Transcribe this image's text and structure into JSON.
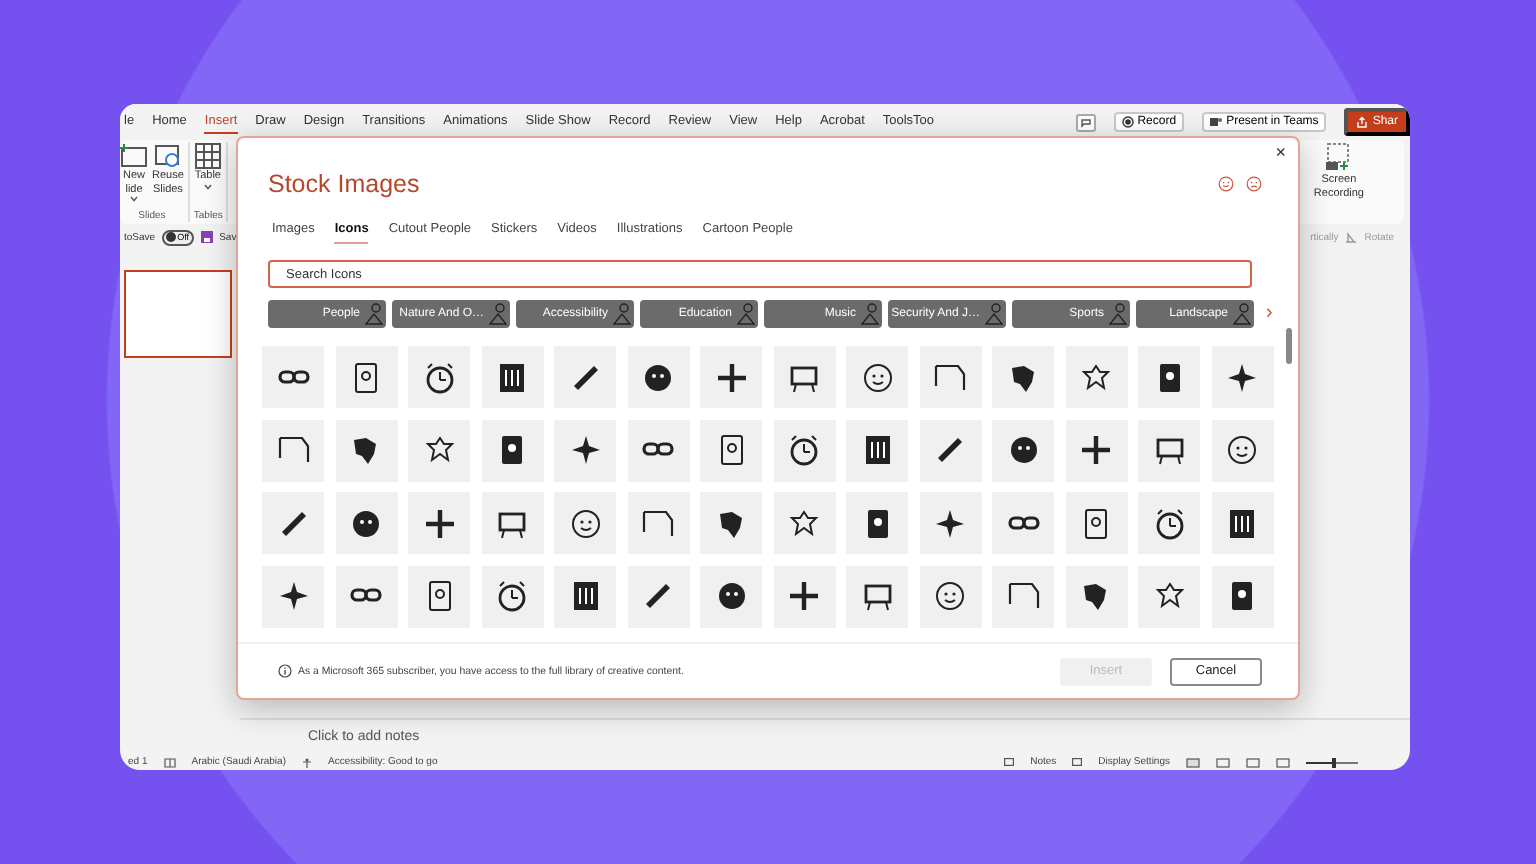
{
  "app": {
    "menu_tabs": [
      {
        "label": "le",
        "selected": false
      },
      {
        "label": "Home",
        "selected": false
      },
      {
        "label": "Insert",
        "selected": true
      },
      {
        "label": "Draw",
        "selected": false
      },
      {
        "label": "Design",
        "selected": false
      },
      {
        "label": "Transitions",
        "selected": false
      },
      {
        "label": "Animations",
        "selected": false
      },
      {
        "label": "Slide Show",
        "selected": false
      },
      {
        "label": "Record",
        "selected": false
      },
      {
        "label": "Review",
        "selected": false
      },
      {
        "label": "View",
        "selected": false
      },
      {
        "label": "Help",
        "selected": false
      },
      {
        "label": "Acrobat",
        "selected": false
      },
      {
        "label": "ToolsToo",
        "selected": false
      }
    ],
    "record_button": "Record",
    "present_button": "Present in Teams",
    "share_button": "Shar",
    "ribbon_groups": [
      {
        "label": "Slides",
        "buttons": [
          {
            "lines": [
              "New",
              "lide"
            ],
            "dropdown": true
          },
          {
            "lines": [
              "Reuse",
              "Slides"
            ],
            "dropdown": false
          }
        ]
      },
      {
        "label": "Tables",
        "buttons": [
          {
            "lines": [
              "Table"
            ],
            "dropdown": true
          }
        ]
      }
    ],
    "screen_recording": [
      "Screen",
      "Recording"
    ],
    "autosave": {
      "label": "toSave",
      "state": "Off",
      "on": false
    },
    "save_label": "Sav",
    "arrange_labels": [
      "rtically",
      "Rotate"
    ],
    "slides": [
      {
        "selected": true
      }
    ],
    "notes_placeholder": "Click to add notes",
    "status_left": [
      "ed 1",
      "Arabic (Saudi Arabia)",
      "Accessibility: Good to go"
    ],
    "status_right": [
      "Notes",
      "Display Settings"
    ],
    "zoom_slider": {
      "level": 0.5
    }
  },
  "dialog": {
    "close_glyph": "×",
    "title": "Stock Images",
    "tabs": [
      {
        "label": "Images",
        "selected": false
      },
      {
        "label": "Icons",
        "selected": true
      },
      {
        "label": "Cutout People",
        "selected": false
      },
      {
        "label": "Stickers",
        "selected": false
      },
      {
        "label": "Videos",
        "selected": false
      },
      {
        "label": "Illustrations",
        "selected": false
      },
      {
        "label": "Cartoon People",
        "selected": false
      }
    ],
    "search": {
      "placeholder": "Search Icons"
    },
    "categories": [
      "People",
      "Nature And O…",
      "Accessibility",
      "Education",
      "Music",
      "Security And J…",
      "Sports",
      "Landscape"
    ],
    "next_glyph": "›",
    "note": "As a Microsoft 365 subscriber, you have access to the full library of creative content.",
    "buttons": [
      {
        "label": "Insert",
        "disabled": true
      },
      {
        "label": "Cancel",
        "disabled": false
      }
    ]
  }
}
